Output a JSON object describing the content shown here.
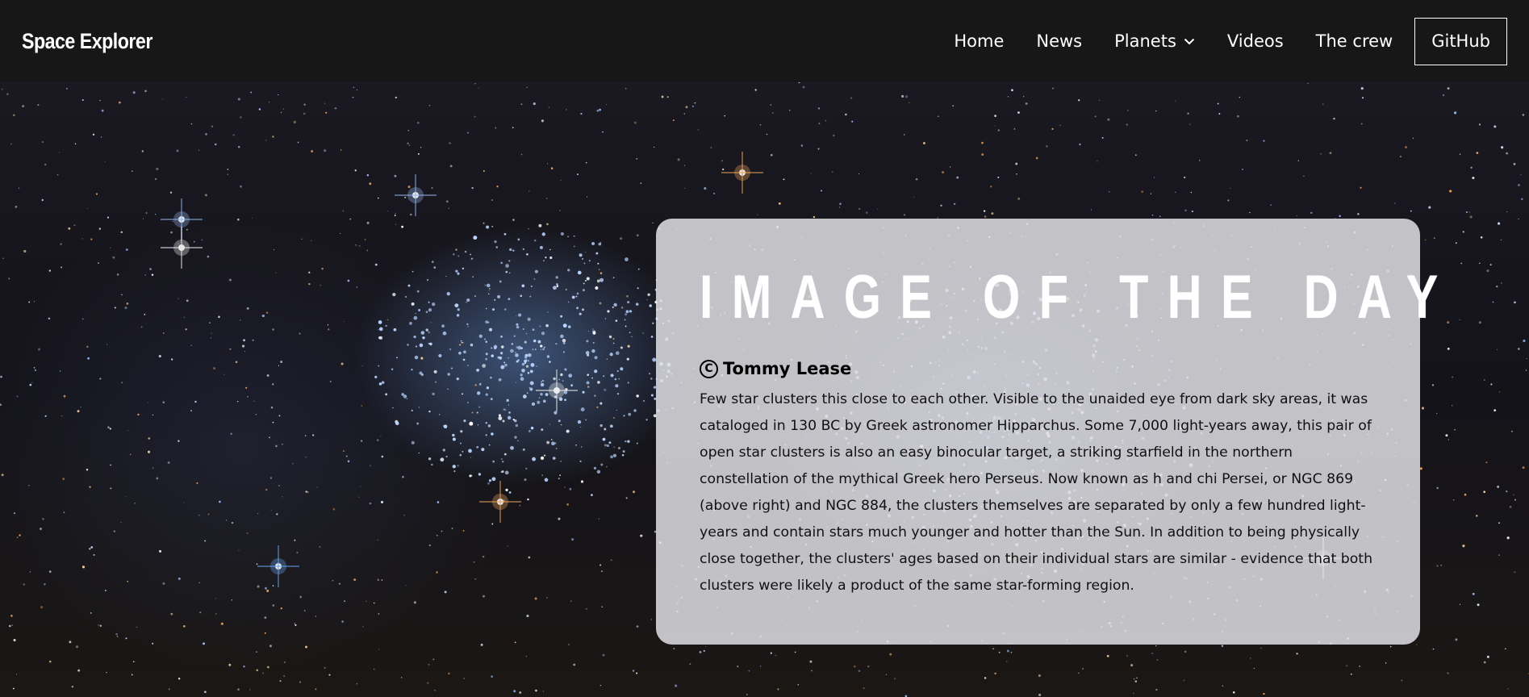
{
  "navbar": {
    "brand": "Space Explorer",
    "links": [
      {
        "label": "Home"
      },
      {
        "label": "News"
      },
      {
        "label": "Planets",
        "has_dropdown": true
      },
      {
        "label": "Videos"
      },
      {
        "label": "The crew"
      }
    ],
    "github_label": "GitHub",
    "background_color": "#171717"
  },
  "image_of_the_day": {
    "title": "IMAGE OF THE DAY",
    "credit_icon": "copyright-icon",
    "credit": "Tommy Lease",
    "description": "Few star clusters this close to each other. Visible to the unaided eye from dark sky areas, it was cataloged in 130 BC by Greek astronomer Hipparchus. Some 7,000 light-years away, this pair of open star clusters is also an easy binocular target, a striking starfield in the northern constellation of the mythical Greek hero Perseus. Now known as h and chi Persei, or NGC 869 (above right) and NGC 884, the clusters themselves are separated by only a few hundred light-years and contain stars much younger and hotter than the Sun. In addition to being physically close together, the clusters' ages based on their individual stars are similar - evidence that both clusters were likely a product of the same star-forming region."
  },
  "colors": {
    "card_background": "#e4e4e8",
    "title_color": "#ffffff",
    "text_color": "#111111"
  }
}
